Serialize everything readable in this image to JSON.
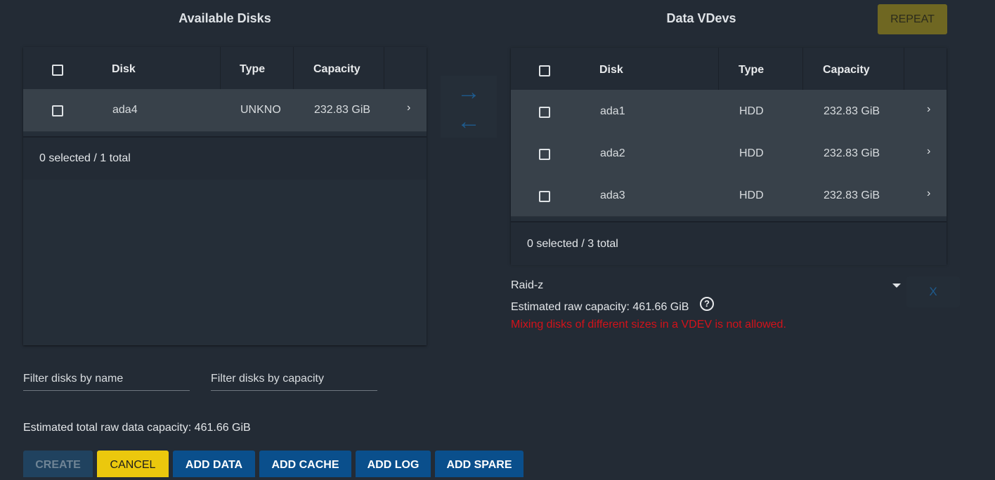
{
  "available": {
    "title": "Available Disks",
    "columns": [
      "Disk",
      "Type",
      "Capacity"
    ],
    "rows": [
      {
        "disk": "ada4",
        "type": "UNKNO",
        "capacity": "232.83 GiB"
      }
    ],
    "footer": "0 selected / 1 total"
  },
  "vdevs": {
    "title": "Data VDevs",
    "repeat_label": "REPEAT",
    "columns": [
      "Disk",
      "Type",
      "Capacity"
    ],
    "rows": [
      {
        "disk": "ada1",
        "type": "HDD",
        "capacity": "232.83 GiB"
      },
      {
        "disk": "ada2",
        "type": "HDD",
        "capacity": "232.83 GiB"
      },
      {
        "disk": "ada3",
        "type": "HDD",
        "capacity": "232.83 GiB"
      }
    ],
    "footer": "0 selected / 3 total",
    "layout_value": "Raid-z",
    "remove_label": "X",
    "estimated_raw_capacity": "Estimated raw capacity: 461.66 GiB",
    "error": "Mixing disks of different sizes in a VDEV is not allowed."
  },
  "transfer": {
    "right_icon": "arrow-right-icon",
    "left_icon": "arrow-left-icon"
  },
  "filters": {
    "name_placeholder": "Filter disks by name",
    "capacity_placeholder": "Filter disks by capacity"
  },
  "summary": "Estimated total raw data capacity: 461.66 GiB",
  "buttons": {
    "create": "CREATE",
    "cancel": "CANCEL",
    "add_data": "ADD DATA",
    "add_cache": "ADD CACHE",
    "add_log": "ADD LOG",
    "add_spare": "ADD SPARE"
  },
  "colors": {
    "background": "#232b35",
    "accent_blue": "#0a4f8c",
    "cancel_yellow": "#ebc80d",
    "error_red": "#d3121a"
  }
}
